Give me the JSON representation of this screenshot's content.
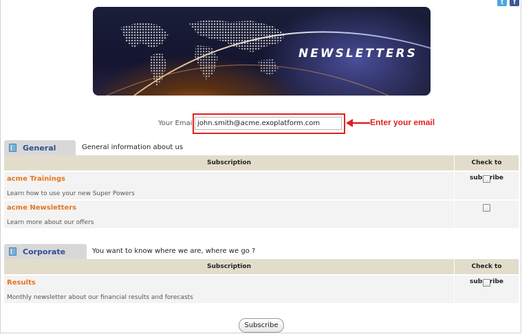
{
  "social": {
    "twitter": "t",
    "facebook": "f"
  },
  "banner": {
    "title": "NEWSLETTERS"
  },
  "email": {
    "label": "Your Email",
    "value": "john.smith@acme.exoplatform.com",
    "callout": "Enter your email"
  },
  "sections": [
    {
      "tab": "General",
      "description": "General information about us",
      "header_subscription": "Subscription",
      "header_check": "Check to subscribe",
      "items": [
        {
          "title": "acme Trainings",
          "description": "Learn how to use your new Super Powers",
          "checked": false
        },
        {
          "title": "acme Newsletters",
          "description": "Learn more about our offers",
          "checked": false
        }
      ]
    },
    {
      "tab": "Corporate",
      "description": "You want to know where we are, where we go ?",
      "header_subscription": "Subscription",
      "header_check": "Check to subscribe",
      "items": [
        {
          "title": "Results",
          "description": "Monthly newsletter about our financial results and forecasts",
          "checked": false
        }
      ]
    }
  ],
  "subscribe_label": "Subscribe",
  "colors": {
    "accent_orange": "#e8751a",
    "tab_blue": "#2e4f8e",
    "callout_red": "#e02020",
    "table_header": "#e2dccb"
  }
}
